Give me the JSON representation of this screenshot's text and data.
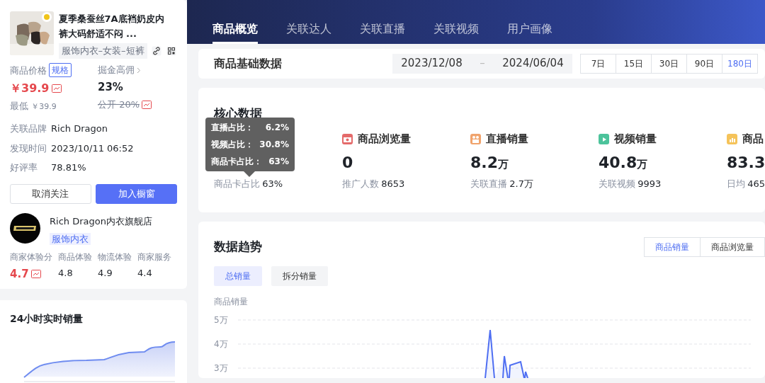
{
  "product": {
    "title": "夏季桑蚕丝7A底裆奶皮内裤大码舒适不闷 ...",
    "category": "服饰内衣–女装–短裤",
    "price_label": "商品价格",
    "spec_tag": "规格",
    "price": "￥39.9",
    "lowest_label": "最低",
    "lowest": "￥39.9",
    "commission_label": "掘金高佣",
    "commission": "23%",
    "public_rate": "公开 20%",
    "info": [
      {
        "label": "关联品牌",
        "value": "Rich Dragon"
      },
      {
        "label": "发现时间",
        "value": "2023/10/11 06:52"
      },
      {
        "label": "好评率",
        "value": "78.81%"
      }
    ],
    "buttons": [
      {
        "label": "取消关注",
        "primary": false
      },
      {
        "label": "加入橱窗",
        "primary": true
      }
    ]
  },
  "shop": {
    "name": "Rich Dragon内衣旗舰店",
    "tag": "服饰内衣",
    "scores": [
      {
        "label": "商家体验分",
        "value": "4.7",
        "highlight": true
      },
      {
        "label": "商品体验",
        "value": "4.8",
        "highlight": false
      },
      {
        "label": "物流体验",
        "value": "4.9",
        "highlight": false
      },
      {
        "label": "商家服务",
        "value": "4.4",
        "highlight": false
      }
    ]
  },
  "realtime": {
    "title": "24小时实时销量"
  },
  "tabs": [
    {
      "label": "商品概览",
      "selected": true
    },
    {
      "label": "关联达人",
      "selected": false
    },
    {
      "label": "关联直播",
      "selected": false
    },
    {
      "label": "关联视频",
      "selected": false
    },
    {
      "label": "用户画像",
      "selected": false
    }
  ],
  "basic": {
    "title": "商品基础数据",
    "start": "2023/12/08",
    "separator": "–",
    "end": "2024/06/04",
    "periods": [
      {
        "label": "7日",
        "selected": false
      },
      {
        "label": "15日",
        "selected": false
      },
      {
        "label": "30日",
        "selected": false
      },
      {
        "label": "90日",
        "selected": false
      },
      {
        "label": "180日",
        "selected": true
      }
    ]
  },
  "core": {
    "title": "核心数据",
    "metrics": [
      {
        "kind": "sales",
        "sub_label": "商品卡占比",
        "sub_value": "63%"
      },
      {
        "kind": "views",
        "label": "商品浏览量",
        "value": "0",
        "sub_label": "推广人数",
        "sub_value": "8653"
      },
      {
        "kind": "live",
        "label": "直播销量",
        "value": "8.2",
        "unit": "万",
        "sub_label": "关联直播",
        "sub_value": "2.7万"
      },
      {
        "kind": "video",
        "label": "视频销量",
        "value": "40.8",
        "unit": "万",
        "sub_label": "关联视频",
        "sub_value": "9993"
      },
      {
        "kind": "card",
        "label": "商品",
        "value": "83.3",
        "sub_label": "日均",
        "sub_value": "465"
      }
    ],
    "tooltip": [
      {
        "label": "直播占比：",
        "value": "6.2%"
      },
      {
        "label": "视频占比：",
        "value": "30.8%"
      },
      {
        "label": "商品卡占比：",
        "value": "63%"
      }
    ]
  },
  "trend": {
    "title": "数据趋势",
    "metric_tabs": [
      {
        "label": "商品销量",
        "selected": true
      },
      {
        "label": "商品浏览量",
        "selected": false
      }
    ],
    "mode_tabs": [
      {
        "label": "总销量",
        "selected": true
      },
      {
        "label": "拆分销量",
        "selected": false
      }
    ],
    "chart": {
      "axis_title": "商品销量",
      "y_labels": [
        "5万",
        "4万",
        "3万"
      ]
    }
  }
}
